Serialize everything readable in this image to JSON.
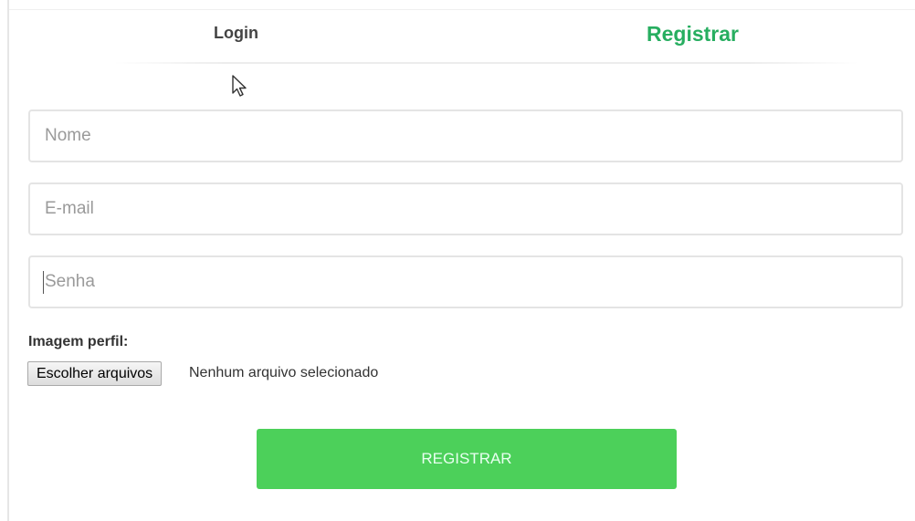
{
  "tabs": {
    "login_label": "Login",
    "register_label": "Registrar"
  },
  "form": {
    "name_placeholder": "Nome",
    "email_placeholder": "E-mail",
    "password_placeholder": "Senha",
    "image_label": "Imagem perfil:",
    "file_button_label": "Escolher arquivos",
    "file_status": "Nenhum arquivo selecionado",
    "submit_label": "REGISTRAR"
  },
  "colors": {
    "active_tab": "#27ae60",
    "submit_background": "#4cd05a"
  }
}
